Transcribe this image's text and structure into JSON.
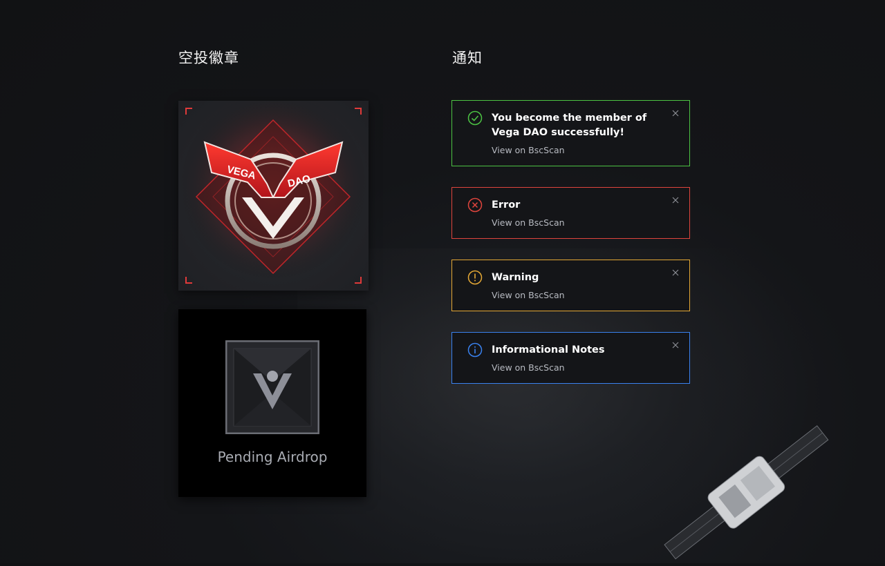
{
  "badges_section": {
    "title": "空投徽章",
    "vega_badge": {
      "left_text": "VEGA",
      "right_text": "DAO"
    },
    "pending_card": {
      "label": "Pending Airdrop"
    }
  },
  "notifications_section": {
    "title": "通知",
    "items": [
      {
        "type": "success",
        "title": "You become the member of Vega DAO successfully!",
        "link": "View on BscScan",
        "color": "#4cc443",
        "icon": "check-circle-icon"
      },
      {
        "type": "error",
        "title": "Error",
        "link": "View on BscScan",
        "color": "#e0453d",
        "icon": "x-circle-icon"
      },
      {
        "type": "warning",
        "title": "Warning",
        "link": "View on BscScan",
        "color": "#e6a935",
        "icon": "exclamation-circle-icon"
      },
      {
        "type": "info",
        "title": "Informational Notes",
        "link": "View on BscScan",
        "color": "#3a82f0",
        "icon": "info-circle-icon"
      }
    ]
  },
  "colors": {
    "background": "#141518",
    "accent_red": "#e03a3a",
    "text_secondary": "#b8bbc2"
  }
}
